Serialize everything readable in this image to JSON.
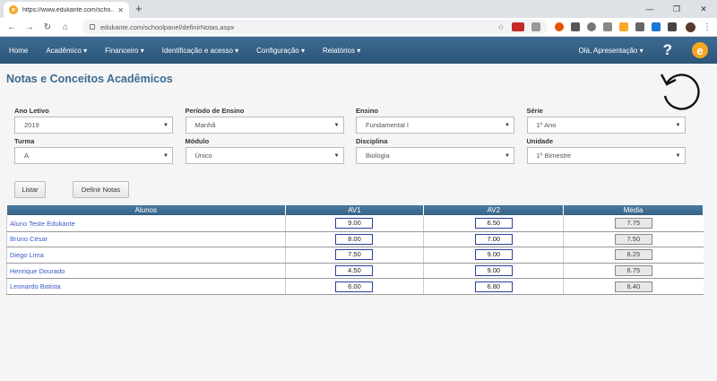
{
  "browser": {
    "tab_title": "https://www.edukante.com/scho...",
    "tab_favicon": "e",
    "url": "edukante.com/schoolpanel/definirNotas.aspx"
  },
  "nav": {
    "items": [
      "Home",
      "Acadêmico ▾",
      "Financeiro ▾",
      "Identificação e acesso ▾",
      "Configuração ▾",
      "Relatórios ▾"
    ],
    "greeting": "Olá, Apresentação ▾",
    "help": "?",
    "logo": "e"
  },
  "page": {
    "title": "Notas e Conceitos Acadêmicos"
  },
  "filters": [
    {
      "label": "Ano Letivo",
      "value": "2019"
    },
    {
      "label": "Período de Ensino",
      "value": "Manhã"
    },
    {
      "label": "Ensino",
      "value": "Fundamental I"
    },
    {
      "label": "Série",
      "value": "1º Ano"
    },
    {
      "label": "Turma",
      "value": "A"
    },
    {
      "label": "Módulo",
      "value": "Único"
    },
    {
      "label": "Disciplina",
      "value": "Biologia"
    },
    {
      "label": "Unidade",
      "value": "1º Bimestre"
    }
  ],
  "buttons": {
    "list": "Listar",
    "define": "Definir Notas"
  },
  "table": {
    "headers": [
      "Alunos",
      "AV1",
      "AV2",
      "Média"
    ],
    "rows": [
      {
        "name": "Aluno Teste Edukante",
        "av1": "9.00",
        "av2": "6.50",
        "media": "7.75"
      },
      {
        "name": "Bruno César",
        "av1": "8.00",
        "av2": "7.00",
        "media": "7.50"
      },
      {
        "name": "Diego Lima",
        "av1": "7.50",
        "av2": "9.00",
        "media": "8.25"
      },
      {
        "name": "Henrique Dourado",
        "av1": "4.50",
        "av2": "9.00",
        "media": "6.75"
      },
      {
        "name": "Leonardo Batista",
        "av1": "6.00",
        "av2": "6.80",
        "media": "6.40"
      }
    ]
  },
  "colors": {
    "nav": "#2c5578",
    "title": "#3d6b93",
    "link": "#3a5bc7",
    "brand": "#f5a623"
  }
}
